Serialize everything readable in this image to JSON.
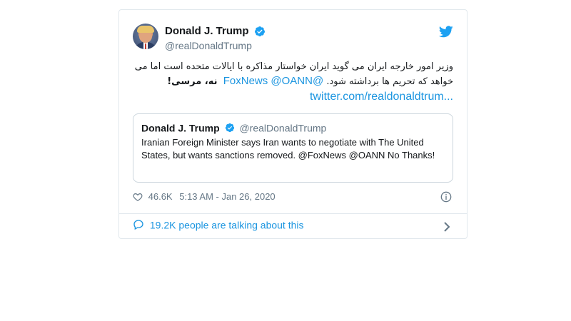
{
  "tweet": {
    "display_name": "Donald J. Trump",
    "handle": "@realDonaldTrump",
    "text_line1": "وزیر امور خارجه ایران می گوید ایران خواستار مذاکره با ایالات متحده است اما می",
    "text_line2_fa_start": "خواهد که تحریم ها برداشته شود.",
    "mention_foxnews": "@FoxNews",
    "mention_oann": "@OANN",
    "text_line2_fa_end": "نه، مرسی!",
    "url": "twitter.com/realdonaldtrum..."
  },
  "quote": {
    "display_name": "Donald J. Trump",
    "handle": "@realDonaldTrump",
    "text": "Iranian Foreign Minister says Iran wants to negotiate with The United States, but wants sanctions removed. @FoxNews  @OANN No Thanks!"
  },
  "meta": {
    "likes": "46.6K",
    "timestamp": "5:13 AM - Jan 26, 2020"
  },
  "footer": {
    "talking": "19.2K people are talking about this"
  },
  "colors": {
    "twitter_blue": "#1da1f2",
    "link_blue": "#1b95e0",
    "secondary_text": "#657786",
    "border": "#e1e8ed"
  },
  "icons": {
    "verified": "verified-badge-icon",
    "bird": "twitter-bird-icon",
    "heart": "heart-icon",
    "info": "info-icon",
    "reply": "speech-bubble-icon",
    "chevron": "chevron-right-icon"
  }
}
